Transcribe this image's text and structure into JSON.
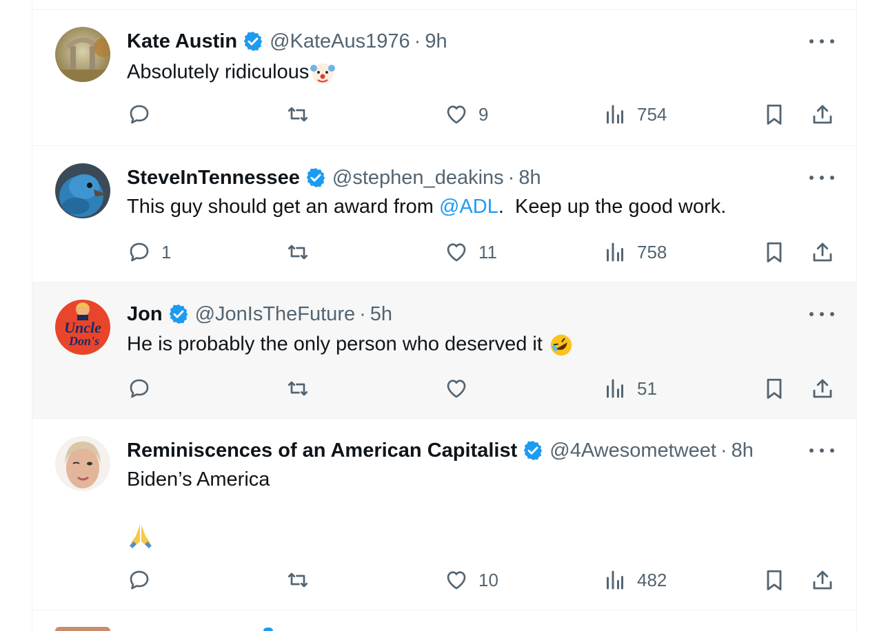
{
  "tweets": [
    {
      "name": "Kate Austin",
      "handle": "@KateAus1976",
      "time": "9h",
      "text": "Absolutely ridiculous",
      "emoji": "clown-face",
      "replies": "",
      "retweets": "",
      "likes": "9",
      "views": "754"
    },
    {
      "name": "SteveInTennessee",
      "handle": "@stephen_deakins",
      "time": "8h",
      "text_before": "This guy should get an award from ",
      "mention": "@ADL",
      "text_after": ".  Keep up the good work.",
      "replies": "1",
      "retweets": "",
      "likes": "11",
      "views": "758"
    },
    {
      "name": "Jon",
      "handle": "@JonIsTheFuture",
      "time": "5h",
      "text": "He is probably the only person who deserved it",
      "emoji": "rolling-on-floor-laughing",
      "avatar_text_1": "Uncle",
      "avatar_text_2": "Don's",
      "replies": "",
      "retweets": "",
      "likes": "",
      "views": "51"
    },
    {
      "name": "Reminiscences of an American Capitalist",
      "handle": "@4Awesometweet",
      "time": "8h",
      "text": "Biden’s America",
      "emoji": "folded-hands",
      "replies": "",
      "retweets": "",
      "likes": "10",
      "views": "482"
    }
  ],
  "separator": "·",
  "colors": {
    "verified": "#1d9bf0",
    "secondary_text": "#536471",
    "mention": "#1d9bf0",
    "hover_row": "#f7f7f7"
  }
}
